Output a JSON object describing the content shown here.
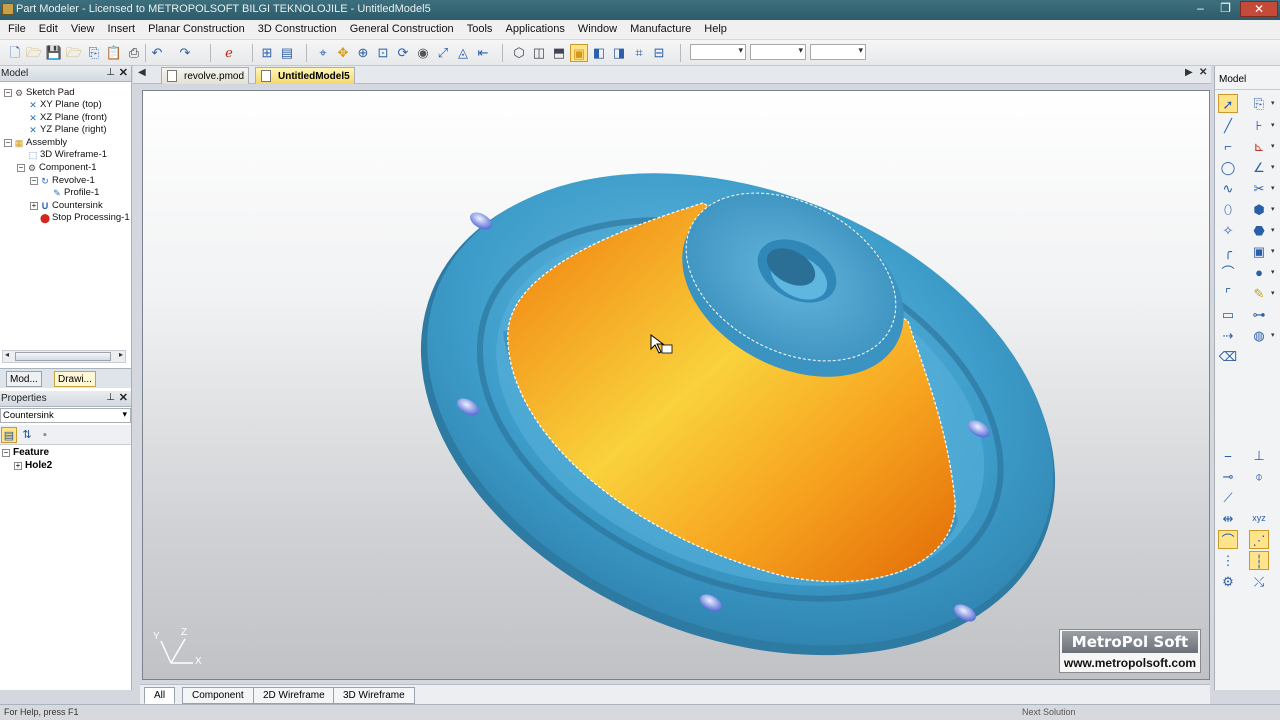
{
  "window": {
    "title": "Part Modeler - Licensed to METROPOLSOFT BILGI TEKNOLOJILE - UntitledModel5",
    "minimize": "–",
    "maximize": "❐",
    "close": "✕"
  },
  "menu": {
    "items": [
      "File",
      "Edit",
      "View",
      "Insert",
      "Planar Construction",
      "3D Construction",
      "General Construction",
      "Tools",
      "Applications",
      "Window",
      "Manufacture",
      "Help"
    ]
  },
  "model_panel": {
    "title": "Model",
    "pin": "⊥",
    "close": "✕",
    "tree": [
      {
        "label": "Sketch Pad",
        "icon": "sketch-pad-icon"
      },
      {
        "label": "XY Plane (top)",
        "icon": "plane-icon"
      },
      {
        "label": "XZ Plane (front)",
        "icon": "plane-icon"
      },
      {
        "label": "YZ Plane (right)",
        "icon": "plane-icon"
      },
      {
        "label": "Assembly",
        "icon": "assembly-icon"
      },
      {
        "label": "3D Wireframe-1",
        "icon": "wireframe-icon"
      },
      {
        "label": "Component-1",
        "icon": "component-icon"
      },
      {
        "label": "Revolve-1",
        "icon": "revolve-icon"
      },
      {
        "label": "Profile-1",
        "icon": "profile-icon"
      },
      {
        "label": "Countersink",
        "icon": "countersink-icon"
      },
      {
        "label": "Stop Processing-1",
        "icon": "stop-icon"
      }
    ],
    "tabs": [
      "Mod...",
      "Drawi..."
    ]
  },
  "properties_panel": {
    "title": "Properties",
    "pin": "⊥",
    "close": "✕",
    "selected": "Countersink",
    "rows": [
      {
        "label": "Feature",
        "expander": "⊟"
      },
      {
        "label": "Hole2",
        "expander": "⊞"
      }
    ]
  },
  "document_tabs": [
    "revolve.pmod",
    "UntitledModel5"
  ],
  "viewport": {
    "axis_y": "Y",
    "axis_z": "Z",
    "axis_x": "X",
    "logo_brand": "MetroPol Soft",
    "logo_url": "www.metropolsoft.com",
    "colors": {
      "part_blue": "#3d9cc9",
      "face_orange": "#f08a14",
      "highlight_yellow": "#f7e046"
    }
  },
  "view_tabs": [
    "All",
    "Component",
    "2D Wireframe",
    "3D Wireframe"
  ],
  "right_panel": {
    "title": "Model"
  },
  "status": {
    "left": "For Help, press F1",
    "right": "Next Solution"
  }
}
